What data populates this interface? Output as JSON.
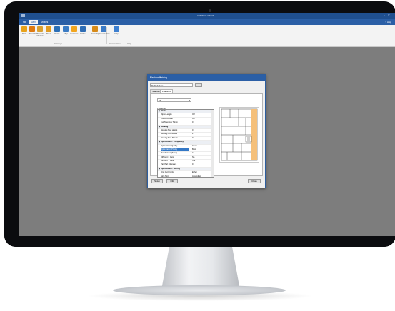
{
  "window": {
    "title": "CABINET VISION"
  },
  "menu": {
    "tabs": [
      "File",
      "Main",
      "Utilities"
    ],
    "active": 1,
    "right": "▾ Help"
  },
  "ribbon": {
    "buttons": [
      {
        "label": "Parts",
        "color": "#e8a21a"
      },
      {
        "label": "Materials",
        "color": "#e07a10"
      },
      {
        "label": "Materials Schedules",
        "color": "#d9a030"
      },
      {
        "label": "Sheet",
        "color": "#e09b22"
      },
      {
        "label": "Doors",
        "color": "#2b6fb7"
      },
      {
        "label": "Edge",
        "color": "#3a7bc4"
      },
      {
        "label": "Hardware",
        "color": "#f2a51e"
      },
      {
        "label": "Profile",
        "color": "#2f6db5"
      },
      {
        "label": "Assembly",
        "color": "#d78a18"
      },
      {
        "label": "Construction",
        "color": "#3b7ac6"
      },
      {
        "label": "Help",
        "color": "#3d7fd0"
      }
    ],
    "groups": [
      "Catalogs",
      "Construction",
      "Help"
    ]
  },
  "dialog": {
    "title": "Machine Catalog",
    "controls": "?  ✕",
    "selected_machine": "Default Saw",
    "tabs": [
      "Standard",
      "Features"
    ],
    "active_tab": 1,
    "feature_select": "All",
    "properties_label": "Properties",
    "properties": [
      {
        "k": "Blank",
        "v": "",
        "cat": true
      },
      {
        "k": "Rip to Length",
        "v": "Off"
      },
      {
        "k": "Cross Cut Half",
        "v": "Off"
      },
      {
        "k": "Cut Tolerance Trimm",
        "v": "0"
      },
      {
        "k": "Booking",
        "v": "",
        "cat": true
      },
      {
        "k": "Booking Max Height",
        "v": "0"
      },
      {
        "k": "Booking Min Sheets",
        "v": "1"
      },
      {
        "k": "Booking Max Sheets",
        "v": "0"
      },
      {
        "k": "Optimization - Complexity",
        "v": "",
        "cat": true
      },
      {
        "k": "Optimization Quality",
        "v": "Good"
      },
      {
        "k": "Optimization Priority",
        "v": "Best",
        "sel": true
      },
      {
        "k": "Max Phases (Saws)",
        "v": "4"
      },
      {
        "k": "Different X Cuts",
        "v": "No"
      },
      {
        "k": "Different Y Cuts",
        "v": "Yes"
      },
      {
        "k": "Part Part Tolerance",
        "v": "0"
      },
      {
        "k": "Optimization - Sorting",
        "v": "",
        "cat": true
      },
      {
        "k": "First Cut Priority",
        "v": "Either"
      },
      {
        "k": "Strip Sort",
        "v": "Ascending"
      }
    ],
    "buttons": {
      "setup": "Setup",
      "ctr": "CtR",
      "close": "Close"
    }
  }
}
